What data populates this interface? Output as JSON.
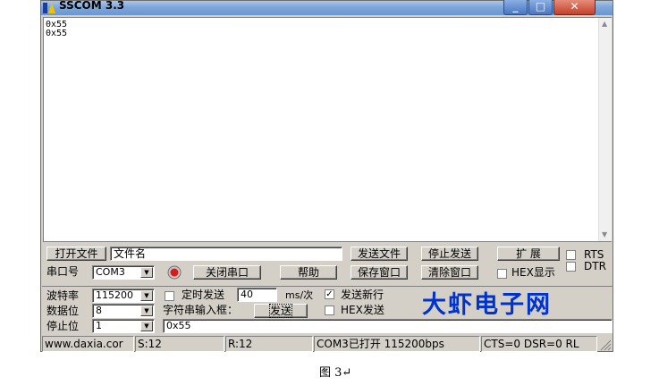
{
  "window": {
    "title": "SSCOM 3.3",
    "minimize": "_",
    "maximize": "□",
    "close": "✕"
  },
  "receive": {
    "lines": [
      "0x55",
      "0x55"
    ]
  },
  "row1": {
    "open_file": "打开文件",
    "filename": "文件名",
    "send_file": "发送文件",
    "stop_send": "停止发送",
    "expand": "扩 展",
    "rts": "RTS",
    "dtr": "DTR"
  },
  "row2": {
    "port_label": "串口号",
    "port_value": "COM3",
    "close_port": "关闭串口",
    "help": "帮助",
    "save_window": "保存窗口",
    "clear_window": "清除窗口",
    "hex_display": "HEX显示"
  },
  "settings": {
    "baud_label": "波特率",
    "baud_value": "115200",
    "databits_label": "数据位",
    "databits_value": "8",
    "stopbits_label": "停止位",
    "stopbits_value": "1"
  },
  "send": {
    "timed_send": "定时发送",
    "interval": "40",
    "unit": "ms/次",
    "newline": "发送新行",
    "input_label": "字符串输入框：",
    "send_button": "发送",
    "hex_send": "HEX发送",
    "input_value": "0x55"
  },
  "brand": "大虾电子网",
  "status": {
    "website": "www.daxia.cor",
    "sent": "S:12",
    "received": "R:12",
    "port_state": "COM3已打开  115200bps",
    "signals": "CTS=0 DSR=0 RL"
  },
  "caption": "图  3↵"
}
